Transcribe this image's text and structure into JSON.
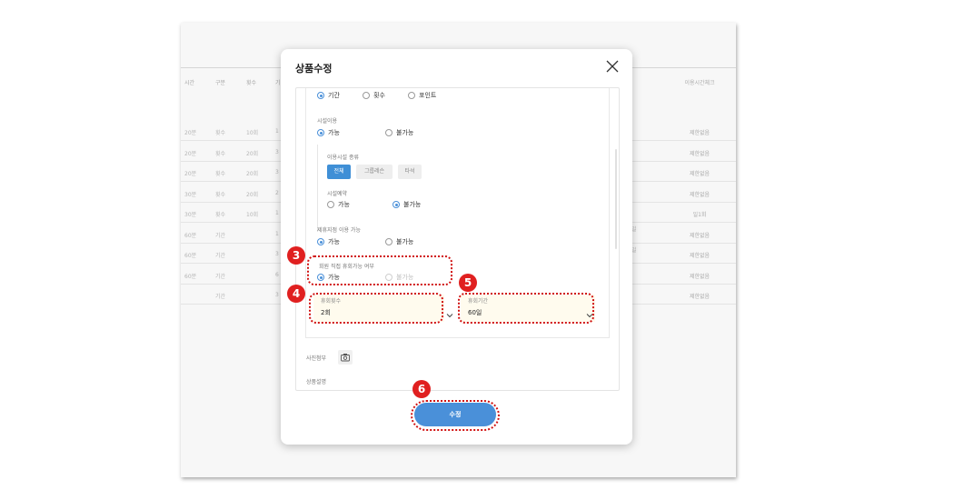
{
  "background_table": {
    "headers": [
      "시간",
      "구분",
      "횟수",
      "기"
    ],
    "last_header": "이용시간체크",
    "rows": [
      {
        "c": [
          "20분",
          "횟수",
          "10회",
          "1"
        ],
        "last": "제한없음"
      },
      {
        "c": [
          "20분",
          "횟수",
          "20회",
          "3"
        ],
        "last": "제한없음"
      },
      {
        "c": [
          "20분",
          "횟수",
          "20회",
          "3"
        ],
        "last": "제한없음"
      },
      {
        "c": [
          "30분",
          "횟수",
          "20회",
          "2"
        ],
        "last": "제한없음"
      },
      {
        "c": [
          "30분",
          "횟수",
          "10회",
          "1"
        ],
        "last": "일1회"
      },
      {
        "c": [
          "60분",
          "기간",
          "",
          "1"
        ],
        "last": "제한없음"
      },
      {
        "c": [
          "60분",
          "기간",
          "",
          "3"
        ],
        "last": "제한없음"
      },
      {
        "c": [
          "60분",
          "기간",
          "",
          "6"
        ],
        "last": "제한없음"
      },
      {
        "c": [
          "",
          "기간",
          "",
          "3"
        ],
        "last": "제한없음"
      }
    ],
    "right_fragments": [
      "일",
      "일"
    ]
  },
  "modal": {
    "title": "상품수정",
    "type_options": [
      "기간",
      "횟수",
      "포인트"
    ],
    "facility_use": {
      "label": "시설이용",
      "options": [
        "가능",
        "불가능"
      ]
    },
    "facility_type": {
      "label": "이용시설 종류",
      "chips": [
        "전체",
        "그룹레슨",
        "타석"
      ]
    },
    "facility_reservation": {
      "label": "시설예약",
      "options": [
        "가능",
        "불가능"
      ]
    },
    "partner_use": {
      "label": "제휴지점 이용 가능",
      "options": [
        "가능",
        "불가능"
      ]
    },
    "pause_available": {
      "label": "회원 직접 휴회가능 여부",
      "options": [
        "가능",
        "불가능"
      ]
    },
    "pause_count": {
      "label": "휴회횟수",
      "value": "2회"
    },
    "pause_period": {
      "label": "휴회기간",
      "value": "60일"
    },
    "photo_label": "사진첨부",
    "description_label": "상품설명",
    "submit_label": "수정"
  },
  "badges": [
    "3",
    "4",
    "5",
    "6"
  ],
  "colors": {
    "accent": "#4a90d9",
    "highlight": "#d01010",
    "field_bg": "#fffbee"
  }
}
